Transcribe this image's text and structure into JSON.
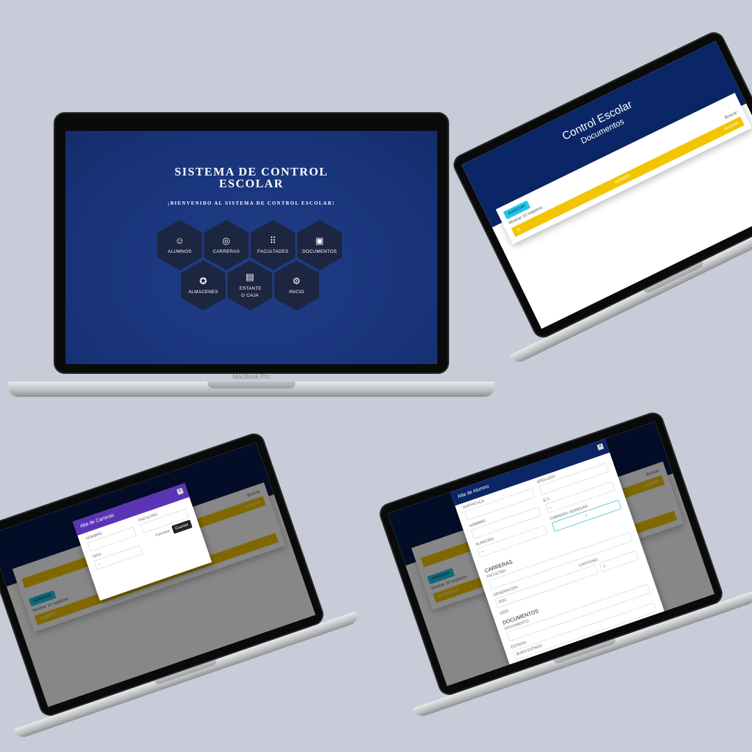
{
  "brand": "MacBook Pro",
  "home": {
    "title": "SISTEMA DE CONTROL ESCOLAR",
    "subtitle": "¡BIENVENIDO AL SISTEMA DE CONTROL ESCOLAR!",
    "tiles": [
      {
        "label": "ALUMNOS",
        "icon": "accessibility-icon"
      },
      {
        "label": "CARRERAS",
        "icon": "target-icon"
      },
      {
        "label": "FACULTADES",
        "icon": "grid-dots-icon"
      },
      {
        "label": "DOCUMENTOS",
        "icon": "id-badge-icon"
      },
      {
        "label": "ALMACENES",
        "icon": "lifebuoy-icon"
      },
      {
        "label": "ESTANTE O CAJA",
        "icon": "clipboard-icon"
      },
      {
        "label": "INICIO",
        "icon": "gear-icon"
      }
    ]
  },
  "docs": {
    "title": "Control Escolar",
    "subtitle": "Documentos",
    "add": "AGREGAR",
    "show": "Mostrar",
    "count": "10",
    "records": "registros",
    "search": "Buscar:",
    "cols": [
      "ID",
      "NOMBRE",
      "Acciones"
    ]
  },
  "carreras": {
    "title": "Control Escolar",
    "modal_title": "Alta de Carreras",
    "nombre": "NOMBRE:",
    "facultad": "FACULTAD:",
    "tipo": "TIPO:",
    "cancel": "Cancelar",
    "save": "Guardar",
    "add": "AGREGAR",
    "show": "Mostrar",
    "count": "10",
    "records": "registros",
    "search": "Buscar:",
    "col_nombre": "NOMBRE",
    "col_acc": "Acciones"
  },
  "alumno": {
    "title": "Control Escolar",
    "modal_title": "Alta de Alumno",
    "matricula": "MATRICULA:",
    "apellido": "APELLIDO:",
    "nombre": "NOMBRE:",
    "ec": "E.C:",
    "almacen": "ALMACEN:",
    "carrera": "CARRERA:",
    "agregar": "AGREGAR:",
    "plus": "+",
    "carreras": "CARRERAS",
    "facultad": "FACULTAD:",
    "generacion": "GENERACION:",
    "gen_value": "2022",
    "cantidad": "CANTIDAD:",
    "cant_value": "1",
    "uedi": "UEDI:",
    "documentos": "DOCUMENTOS",
    "documento": "DOCUMENTO:",
    "estado": "ESTADO:",
    "estado_value": "BUEN ESTADO",
    "add": "AGREGAR",
    "show": "Mostrar",
    "count": "10",
    "records": "registros",
    "search": "Buscar:",
    "col_acc": "Acciones",
    "row_label": "MATRICULA"
  },
  "colors": {
    "navy": "#0b2666",
    "yellow": "#f2c500",
    "cyan": "#1ec8e6",
    "purple": "#5b34b5"
  }
}
